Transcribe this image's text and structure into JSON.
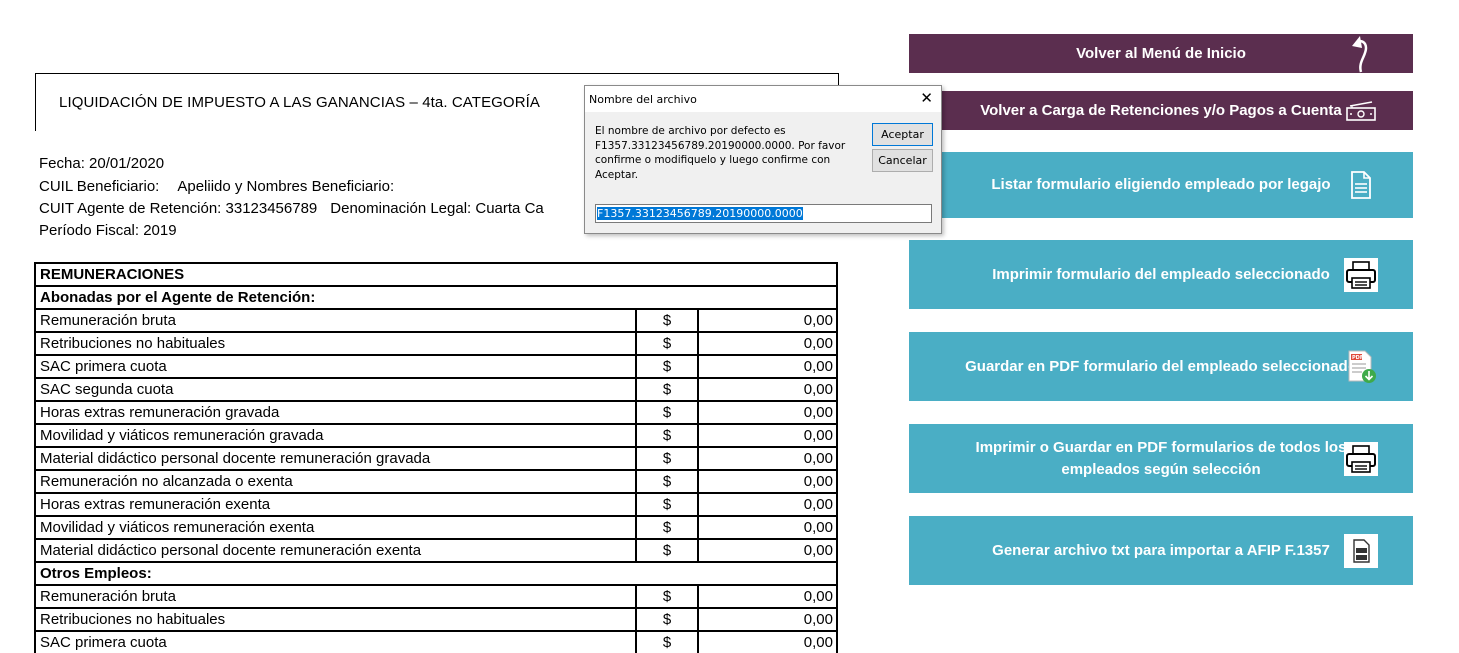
{
  "title": "LIQUIDACIÓN DE IMPUESTO A LAS GANANCIAS – 4ta. CATEGORÍA",
  "info": {
    "fecha": "Fecha: 20/01/2020",
    "cuil_label": "CUIL Beneficiario:",
    "cuil_name": "Apeliido y Nombres Beneficiario:",
    "cuit": "CUIT Agente de Retención: 33123456789",
    "denominacion": "Denominación Legal: Cuarta Ca",
    "periodo": "Período Fiscal:  2019"
  },
  "table": {
    "section": "REMUNERACIONES",
    "group1": "Abonadas por el Agente de Retención:",
    "group1_rows": [
      {
        "label": "Remuneración bruta",
        "cur": "$",
        "value": "0,00"
      },
      {
        "label": "Retribuciones no habituales",
        "cur": "$",
        "value": "0,00"
      },
      {
        "label": "SAC primera cuota",
        "cur": "$",
        "value": "0,00"
      },
      {
        "label": "SAC segunda cuota",
        "cur": "$",
        "value": "0,00"
      },
      {
        "label": "Horas extras remuneración gravada",
        "cur": "$",
        "value": "0,00"
      },
      {
        "label": "Movilidad y viáticos remuneración gravada",
        "cur": "$",
        "value": "0,00"
      },
      {
        "label": "Material didáctico personal docente remuneración gravada",
        "cur": "$",
        "value": "0,00"
      },
      {
        "label": "Remuneración no alcanzada o exenta",
        "cur": "$",
        "value": "0,00"
      },
      {
        "label": "Horas extras remuneración exenta",
        "cur": "$",
        "value": "0,00"
      },
      {
        "label": "Movilidad y viáticos remuneración exenta",
        "cur": "$",
        "value": "0,00"
      },
      {
        "label": "Material didáctico personal docente remuneración exenta",
        "cur": "$",
        "value": "0,00"
      }
    ],
    "group2": "Otros Empleos:",
    "group2_rows": [
      {
        "label": "Remuneración bruta",
        "cur": "$",
        "value": "0,00"
      },
      {
        "label": "Retribuciones no habituales",
        "cur": "$",
        "value": "0,00"
      },
      {
        "label": "SAC primera cuota",
        "cur": "$",
        "value": "0,00"
      }
    ]
  },
  "buttons": {
    "volver_menu": "Volver al Menú de Inicio",
    "volver_carga": "Volver a Carga de Retenciones y/o Pagos a Cuenta",
    "listar": "Listar formulario eligiendo empleado por legajo",
    "imprimir": "Imprimir formulario del empleado seleccionado",
    "guardar_pdf": "Guardar en PDF formulario del empleado seleccionado",
    "imprimir_todos": "Imprimir o Guardar en PDF formularios de todos los empleados según selección",
    "generar_txt": "Generar archivo txt para importar a AFIP F.1357"
  },
  "dialog": {
    "title": "Nombre del archivo",
    "message": "El nombre de archivo por defecto es F1357.33123456789.20190000.0000. Por favor confirme o modifiquelo y luego confirme con Aceptar.",
    "ok": "Aceptar",
    "cancel": "Cancelar",
    "input_value": "F1357.33123456789.20190000.0000"
  },
  "colors": {
    "purple": "#5b2e4f",
    "teal": "#4aaec5"
  },
  "icons": {
    "volver_menu": "return-arrow-icon",
    "volver_carga": "money-icon",
    "listar": "document-icon",
    "imprimir": "printer-icon",
    "guardar_pdf": "pdf-download-icon",
    "imprimir_todos": "printer-icon",
    "generar_txt": "txt-file-icon"
  }
}
